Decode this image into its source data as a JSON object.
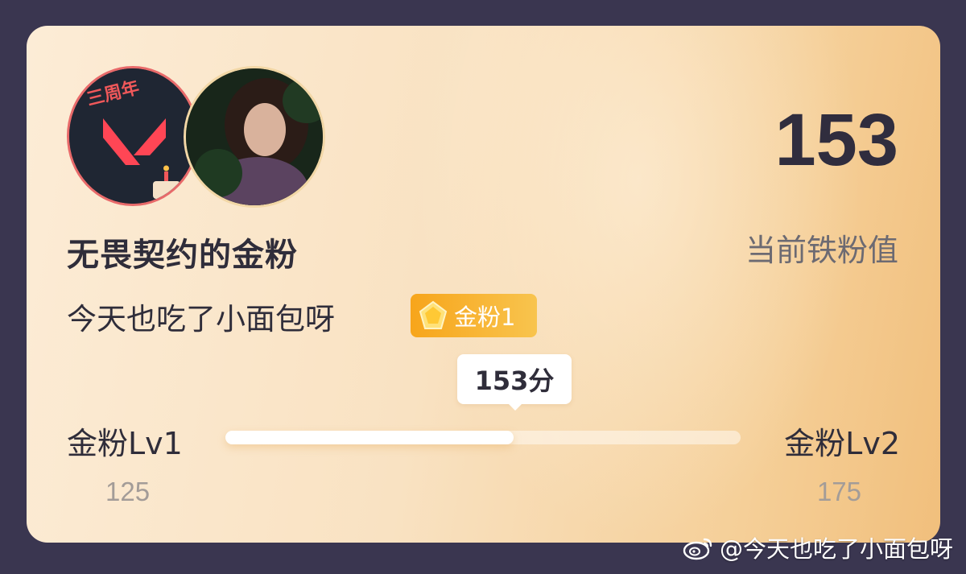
{
  "card": {
    "badge_avatar_text": "三周年",
    "title": "无畏契约的金粉",
    "subtitle": "今天也吃了小面包呀",
    "fan_badge": {
      "label": "金粉1",
      "icon": "gem-icon"
    },
    "score": "153",
    "score_label": "当前铁粉值",
    "progress": {
      "tooltip": "153分",
      "level_left": "金粉Lv1",
      "level_right": "金粉Lv2",
      "min_label": "125",
      "max_label": "175",
      "min": 125,
      "max": 175,
      "value": 153
    }
  },
  "watermark": {
    "text": "@今天也吃了小面包呀",
    "icon": "weibo-logo-icon"
  },
  "colors": {
    "background": "#3a3650",
    "badge": "#f7a51b",
    "text_dark": "#2f2d3a",
    "text_muted": "#a39c98"
  }
}
